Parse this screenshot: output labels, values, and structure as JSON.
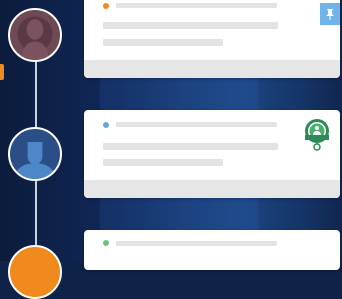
{
  "colors": {
    "accent_orange": "#f08a1c",
    "dot_blue": "#6aa6dc",
    "dot_green": "#63c57d",
    "pin_blue": "#6fb3e8",
    "award_green": "#2e8b57"
  },
  "timeline": [
    {
      "avatar_icon": "user-female-icon",
      "dot_color": "#f08a1c",
      "badge_icon": "pin-icon"
    },
    {
      "avatar_icon": "user-male-icon",
      "dot_color": "#6aa6dc",
      "badge_icon": "award-icon"
    },
    {
      "avatar_icon": "user-icon",
      "dot_color": "#63c57d",
      "badge_icon": ""
    }
  ]
}
